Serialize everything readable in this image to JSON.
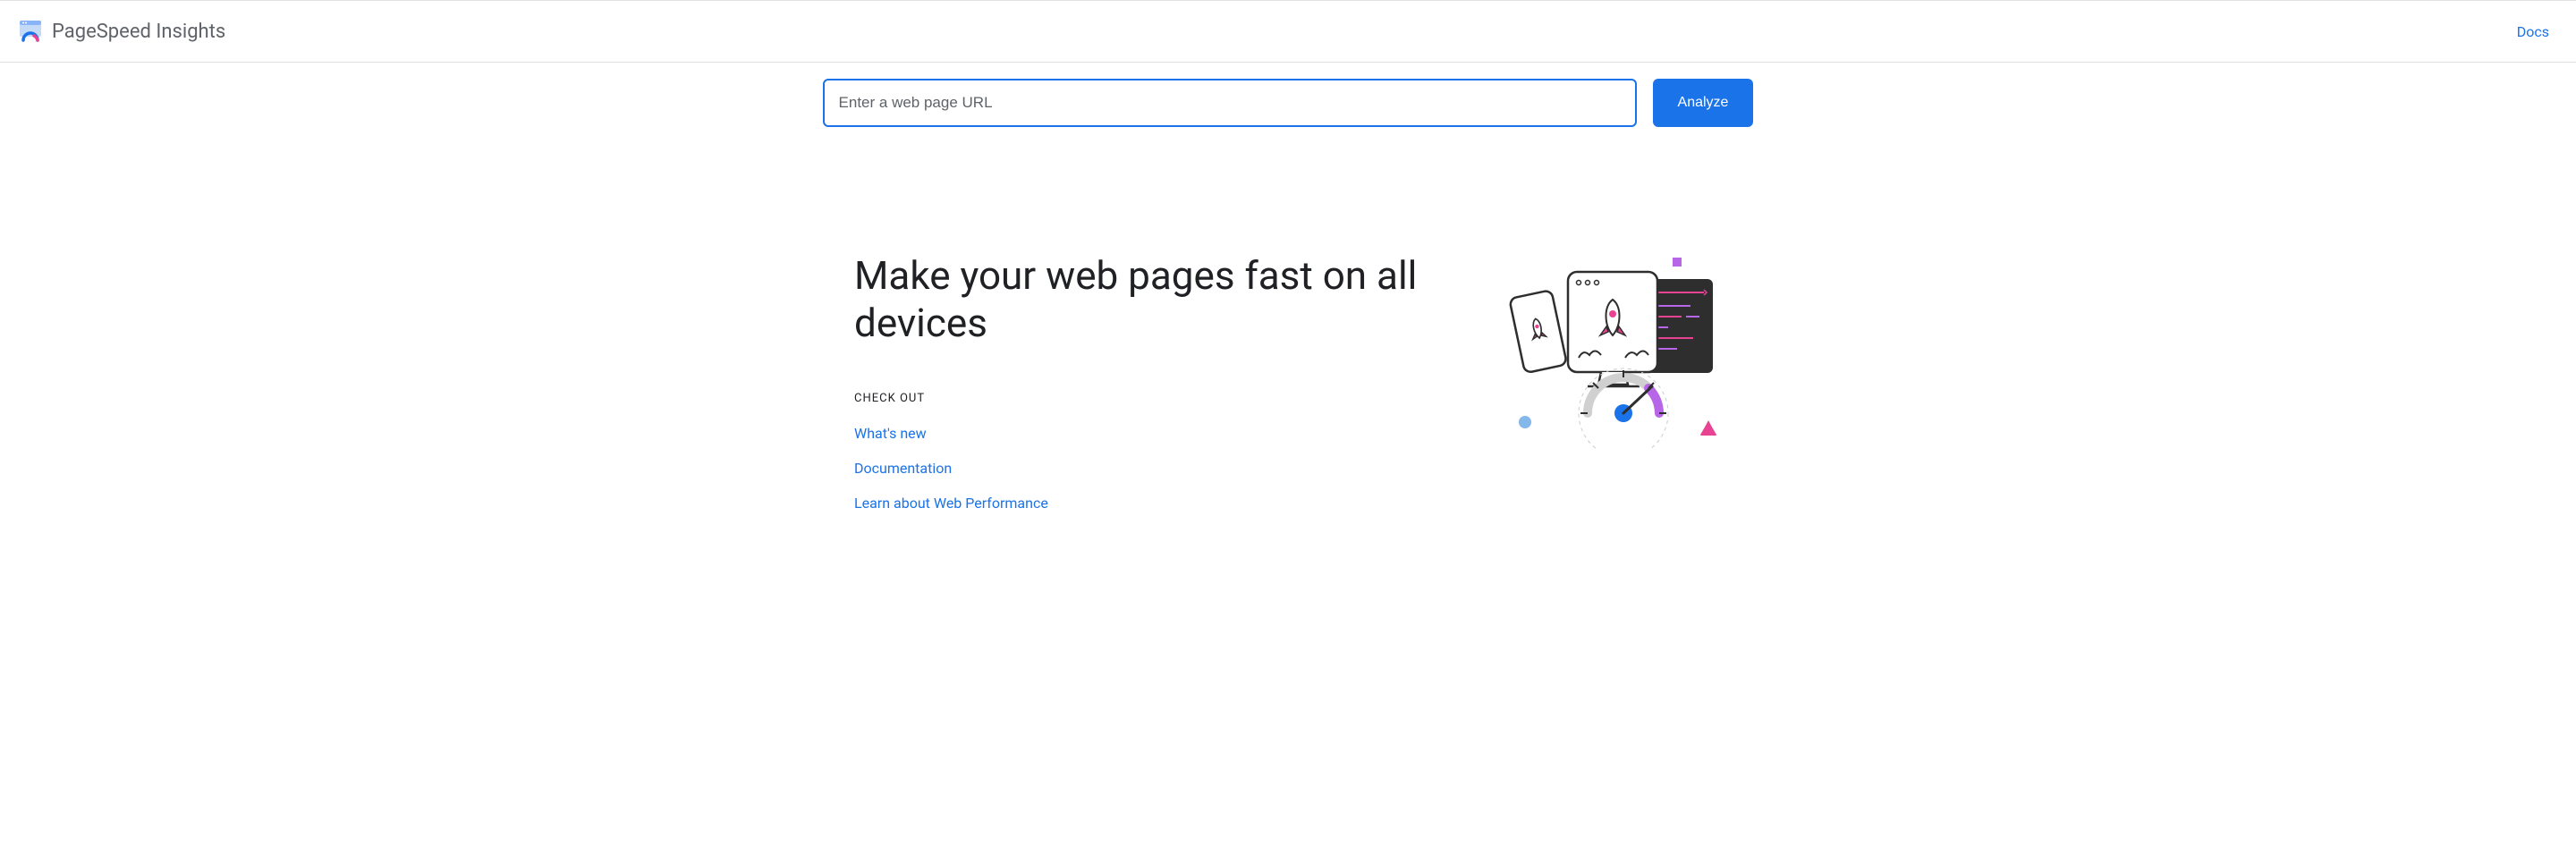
{
  "header": {
    "brand": "PageSpeed Insights",
    "docs_link": "Docs"
  },
  "search": {
    "placeholder": "Enter a web page URL",
    "value": "",
    "analyze_label": "Analyze"
  },
  "main": {
    "headline": "Make your web pages fast on all devices",
    "checkout_label": "CHECK OUT",
    "links": [
      {
        "label": "What's new"
      },
      {
        "label": "Documentation"
      },
      {
        "label": "Learn about Web Performance"
      }
    ]
  }
}
